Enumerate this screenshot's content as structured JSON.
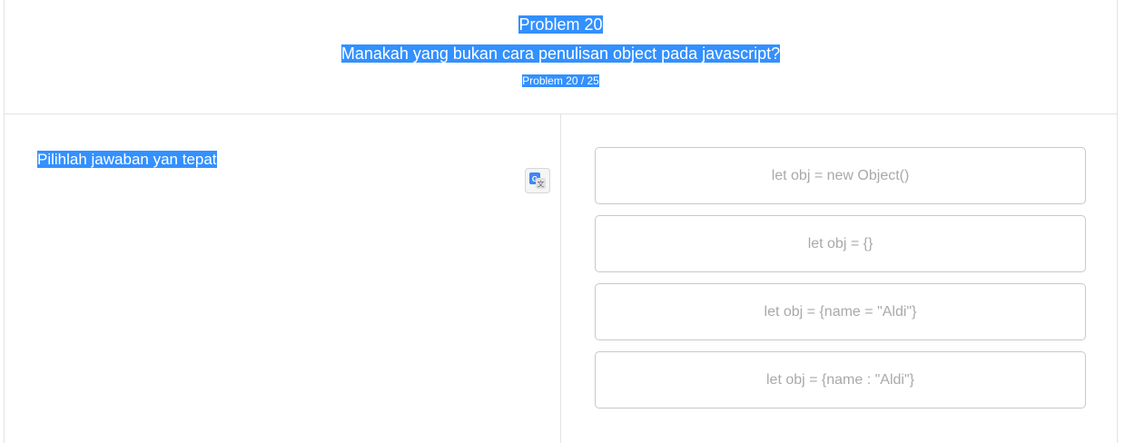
{
  "header": {
    "title": "Problem 20",
    "question": "Manakah yang bukan cara penulisan object pada javascript?",
    "counter": "Problem 20 / 25"
  },
  "instruction": "Pilihlah jawaban yan tepat",
  "translate_icon": "google-translate-icon",
  "options": [
    "let obj = new Object()",
    "let obj = {}",
    "let obj = {name = \"Aldi\"}",
    "let obj = {name : \"Aldi\"}"
  ],
  "colors": {
    "selection": "#3390ff",
    "border": "#c8c8c8",
    "option_text": "#a9a9a9"
  }
}
